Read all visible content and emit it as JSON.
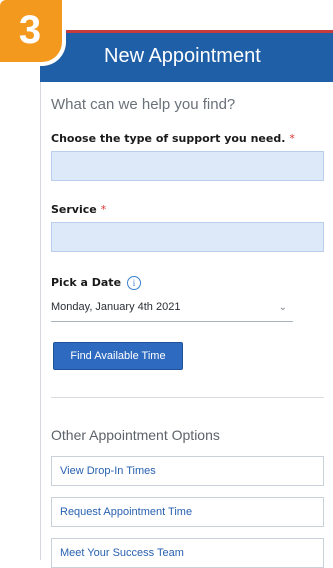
{
  "step_badge": "3",
  "header": {
    "title": "New Appointment",
    "back_icon": "chevron-left-icon"
  },
  "form": {
    "lead": "What can we help you find?",
    "support_type_label": "Choose the type of support you need.",
    "support_type_value": "",
    "service_label": "Service",
    "service_value": "",
    "required_marker": "*",
    "date_label": "Pick a Date",
    "date_info_icon": "info-icon",
    "date_value": "Monday, January 4th 2021",
    "find_button": "Find Available Time"
  },
  "other": {
    "heading": "Other Appointment Options",
    "options": [
      "View Drop-In Times",
      "Request Appointment Time",
      "Meet Your Success Team"
    ]
  },
  "colors": {
    "header": "#1f5fa7",
    "badge": "#f39a1e",
    "button": "#2e6ac0"
  }
}
